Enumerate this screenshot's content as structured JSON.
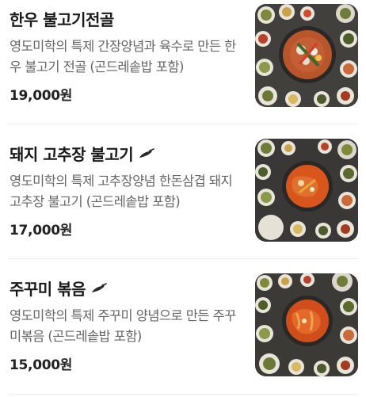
{
  "menu": {
    "items": [
      {
        "name": "한우 불고기전골",
        "description": "영도미학의 특제 간장양념과 육수로 만든 한우 불고기 전골 (곤드레솥밥 포함)",
        "price": "19,000원",
        "spicy_icon": null
      },
      {
        "name": "돼지 고추장 불고기",
        "description": "영도미학의 특제 고추장양념 한돈삼겹 돼지 고추장 불고기 (곤드레솥밥 포함)",
        "price": "17,000원",
        "spicy_icon": "chili-pepper-icon"
      },
      {
        "name": "주꾸미 볶음",
        "description": "영도미학의 특제 주꾸미 양념으로 만든 주꾸미볶음 (곤드레솥밥 포함)",
        "price": "15,000원",
        "spicy_icon": "chili-pepper-icon"
      }
    ]
  },
  "colors": {
    "chili": "#2a2a2a",
    "table": "#3b3a38",
    "bulgogi_pot": "#b8552a",
    "spicy_sauce": "#d8561c"
  }
}
